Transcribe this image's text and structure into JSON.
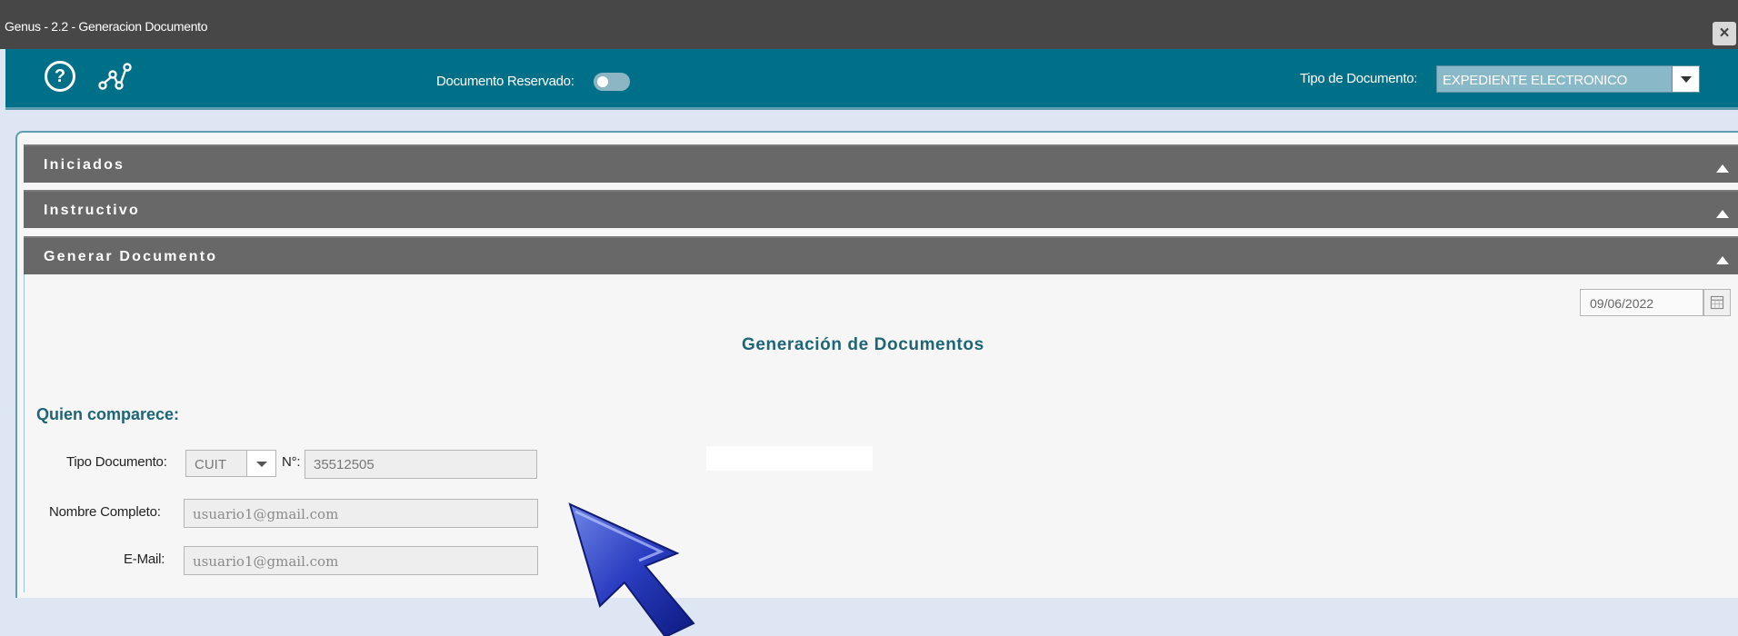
{
  "window": {
    "title": "Genus - 2.2 - Generacion Documento",
    "close_label": "×"
  },
  "toolbar": {
    "help_icon": "question-circle-icon",
    "flow_icon": "workflow-nodes-icon",
    "reservado_label": "Documento Reservado:",
    "reservado_toggle_on": false,
    "tipo_label": "Tipo de Documento:",
    "tipo_value": "EXPEDIENTE ELECTRONICO"
  },
  "accordion": {
    "sections": [
      {
        "label": "Iniciados"
      },
      {
        "label": "Instructivo"
      },
      {
        "label": "Generar Documento"
      }
    ]
  },
  "form": {
    "date_value": "09/06/2022",
    "title": "Generación de Documentos",
    "section_title": "Quien comparece:",
    "tipo_documento_label": "Tipo Documento:",
    "tipo_documento_value": "CUIT",
    "numero_label": "N°:",
    "numero_value": "35512505",
    "nombre_label": "Nombre Completo:",
    "nombre_value": "usuario1@gmail.com",
    "email_label": "E-Mail:",
    "email_value": "usuario1@gmail.com"
  },
  "colors": {
    "toolbar": "#007089",
    "titlebar": "#474747",
    "accordion_header": "#686868",
    "accent_text": "#1e6576",
    "cursor": "#1a2ea8"
  }
}
